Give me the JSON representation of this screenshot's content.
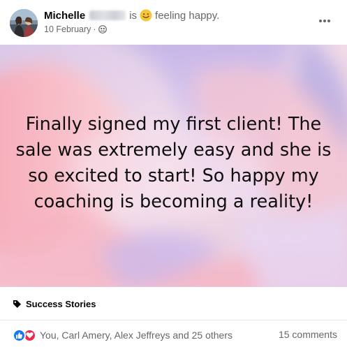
{
  "post": {
    "author_name": "Michelle",
    "status_is": "is",
    "feeling_icon": "smile-emoji-icon",
    "feeling_text": "feeling happy.",
    "date": "10 February",
    "separator": "·",
    "audience_icon": "group-icon",
    "more_icon": "more-options-icon",
    "image_text": "Finally signed my first client! The sale was extremely easy and she is so excited to start! So happy my coaching is becoming a reality!",
    "topic_tag": "Success Stories"
  },
  "engagement": {
    "reaction_icons": [
      "like-icon",
      "love-icon"
    ],
    "reaction_names": "You, Carl Amery, Alex Jeffreys and 25 others",
    "comments_count": "15 comments"
  },
  "colors": {
    "like_blue": "#1877f2",
    "love_red": "#f0284a",
    "secondary_text": "#65676b",
    "emoji_yellow": "#f7c538"
  }
}
